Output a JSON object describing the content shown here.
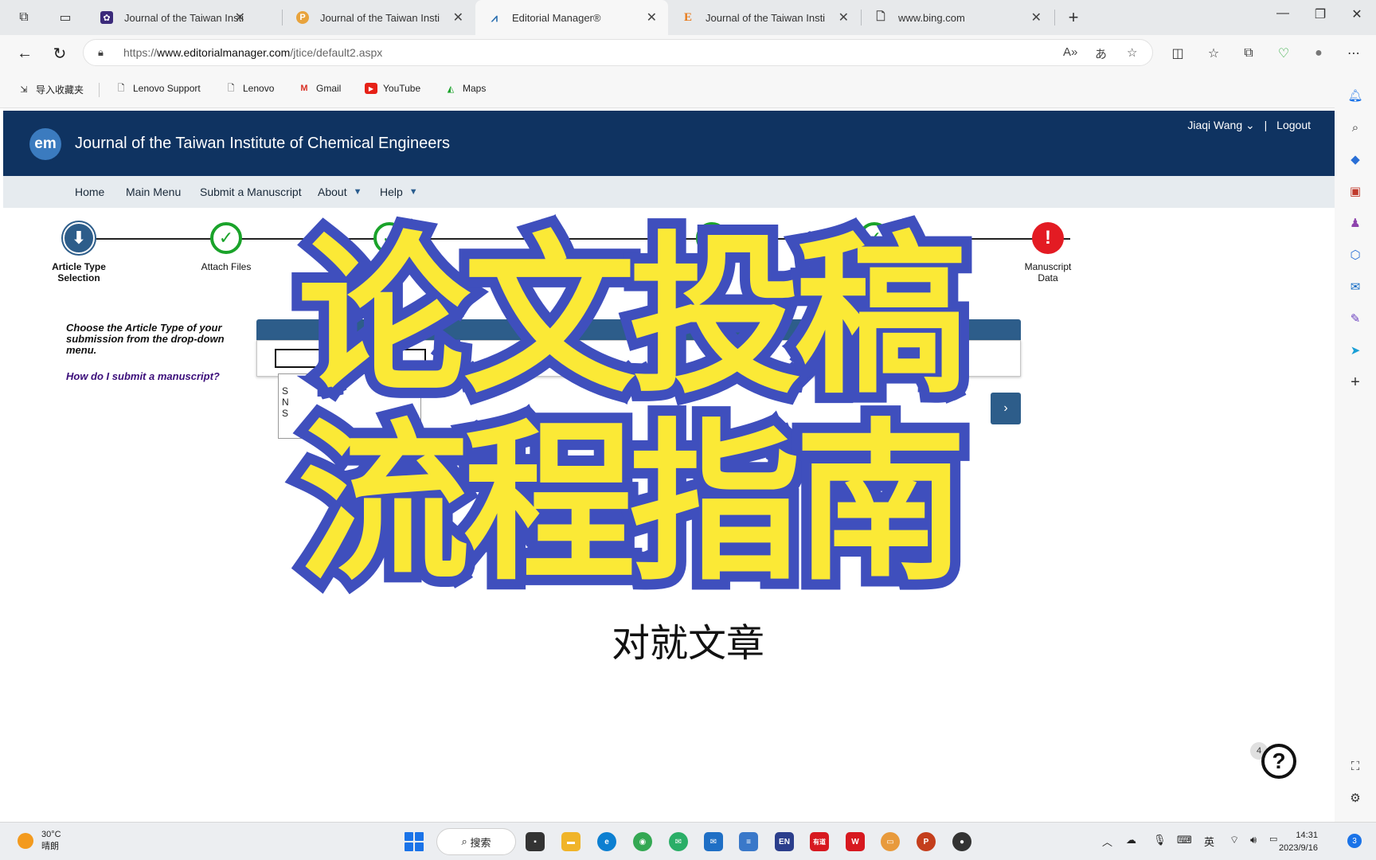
{
  "browser": {
    "tabs": [
      {
        "title": "Journal of the Taiwan Instit",
        "icon": "elsevier-icon",
        "color": "#3b2a7a"
      },
      {
        "title": "Journal of the Taiwan Instit",
        "icon": "p-icon",
        "color": "#e8a33c"
      },
      {
        "title": "Editorial Manager®",
        "icon": "editorial-manager-icon",
        "color": "#2a6fb0"
      },
      {
        "title": "Journal of the Taiwan Instit",
        "icon": "e-icon",
        "color": "#e87a1a"
      },
      {
        "title": "www.bing.com",
        "icon": "page-icon",
        "color": "#555555"
      }
    ],
    "url_prefix": "https://",
    "url_domain": "www.editorialmanager.com",
    "url_path": "/jtice/default2.aspx",
    "bookmarks": [
      {
        "label": "导入收藏夹",
        "icon": "import-icon"
      },
      {
        "label": "Lenovo Support",
        "icon": "page-icon"
      },
      {
        "label": "Lenovo",
        "icon": "page-icon"
      },
      {
        "label": "Gmail",
        "icon": "gmail-icon"
      },
      {
        "label": "YouTube",
        "icon": "youtube-icon"
      },
      {
        "label": "Maps",
        "icon": "maps-icon"
      }
    ]
  },
  "site": {
    "logo": "em",
    "journal_title": "Journal of the Taiwan Institute of Chemical Engineers",
    "user_name": "Jiaqi Wang",
    "logout": "Logout",
    "nav": [
      "Home",
      "Main Menu",
      "Submit a Manuscript",
      "About",
      "Help"
    ]
  },
  "steps": [
    {
      "label": "Article Type Selection",
      "state": "current"
    },
    {
      "label": "Attach Files",
      "state": "done"
    },
    {
      "label": "",
      "state": "done"
    },
    {
      "label": "",
      "state": "done"
    },
    {
      "label": "",
      "state": "done"
    },
    {
      "label": "",
      "state": "done"
    },
    {
      "label": "Manuscript Data",
      "state": "error"
    }
  ],
  "content": {
    "instruction": "Choose the Article Type of your submission from the drop-down menu.",
    "howto_link": "How do I submit a manuscript?",
    "dropdown_fragments": [
      "",
      "S",
      "N",
      "S",
      "nd Res"
    ]
  },
  "overlay": {
    "line1": "论文投稿",
    "line2": "流程指南",
    "subtitle": "对就文章",
    "fill_color": "#fbe936",
    "stroke_color": "#3f4fbd"
  },
  "help_badge": "4",
  "taskbar": {
    "temp": "30°C",
    "weather": "晴朗",
    "search": "搜索",
    "ime": "英",
    "time": "14:31",
    "date": "2023/9/16",
    "notifications": "3",
    "en_label": "EN",
    "youdao_label": "有道"
  }
}
